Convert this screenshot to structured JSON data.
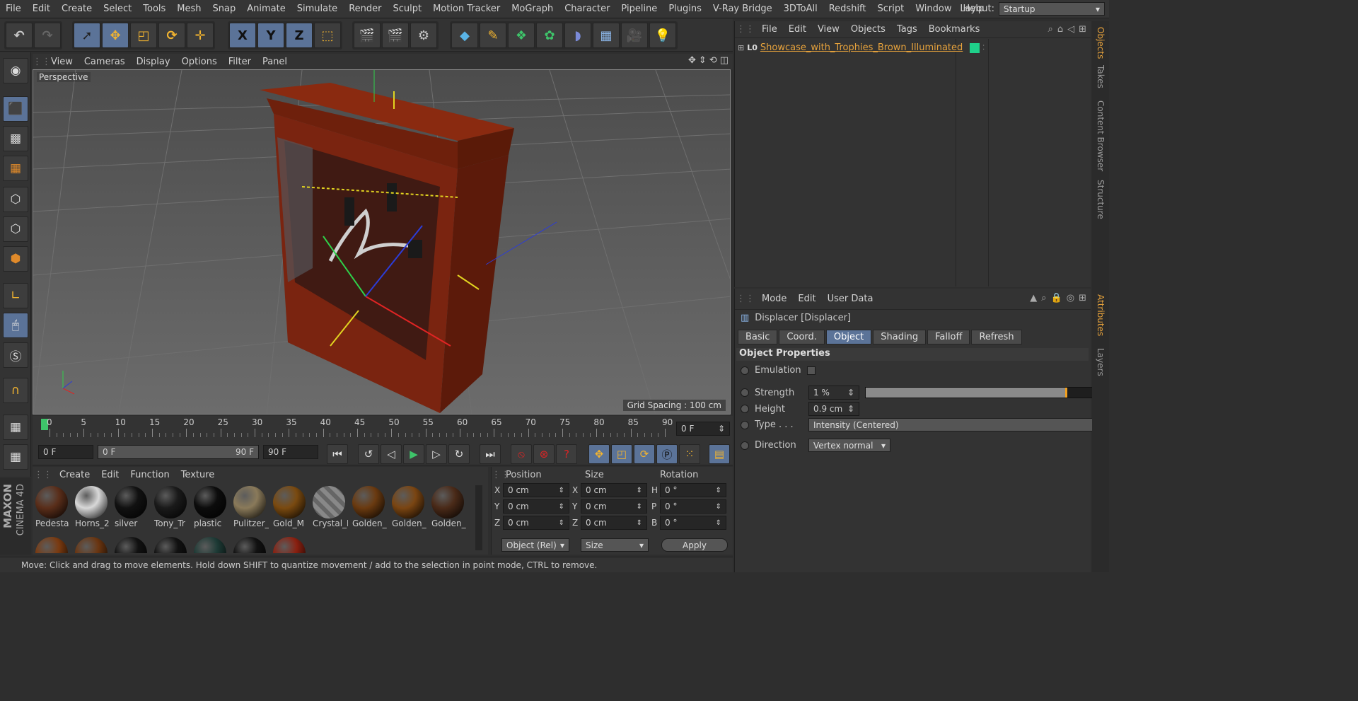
{
  "menubar": {
    "items": [
      "File",
      "Edit",
      "Create",
      "Select",
      "Tools",
      "Mesh",
      "Snap",
      "Animate",
      "Simulate",
      "Render",
      "Sculpt",
      "Motion Tracker",
      "MoGraph",
      "Character",
      "Pipeline",
      "Plugins",
      "V-Ray Bridge",
      "3DToAll",
      "Redshift",
      "Script",
      "Window",
      "Help"
    ],
    "layout_label": "Layout:",
    "layout_value": "Startup"
  },
  "toolbar": {
    "axes": [
      "X",
      "Y",
      "Z"
    ]
  },
  "viewport": {
    "menu": [
      "View",
      "Cameras",
      "Display",
      "Options",
      "Filter",
      "Panel"
    ],
    "label": "Perspective",
    "grid_spacing": "Grid Spacing : 100 cm"
  },
  "timeline": {
    "ticks": [
      "0",
      "5",
      "10",
      "15",
      "20",
      "25",
      "30",
      "35",
      "40",
      "45",
      "50",
      "55",
      "60",
      "65",
      "70",
      "75",
      "80",
      "85",
      "90"
    ],
    "current_frame": "0 F"
  },
  "transport": {
    "start": "0 F",
    "range_start": "0 F",
    "range_end": "90 F",
    "end": "90 F"
  },
  "materials": {
    "menu": [
      "Create",
      "Edit",
      "Function",
      "Texture"
    ],
    "items": [
      {
        "name": "Pedesta",
        "color": "#5a2e1a"
      },
      {
        "name": "Horns_2",
        "color": "#d8d8d8"
      },
      {
        "name": "silver",
        "color": "#111111"
      },
      {
        "name": "Tony_Tr",
        "color": "#1a1a1a"
      },
      {
        "name": "plastic",
        "color": "#0c0c0c"
      },
      {
        "name": "Pulitzer_",
        "color": "#8a7a5a"
      },
      {
        "name": "Gold_M",
        "color": "#7a4a10"
      },
      {
        "name": "Crystal_I",
        "color": "#777777"
      },
      {
        "name": "Golden_",
        "color": "#6a3a10"
      },
      {
        "name": "Golden_",
        "color": "#7a4512"
      },
      {
        "name": "Golden_",
        "color": "#4a2a18"
      }
    ],
    "row2": [
      "#7a3a10",
      "#6a3510",
      "#111111",
      "#111111",
      "#1d3a35",
      "#111111",
      "#8a2010"
    ]
  },
  "coords": {
    "headers": [
      "Position",
      "Size",
      "Rotation"
    ],
    "rows": [
      {
        "a": "X",
        "p": "0 cm",
        "b": "X",
        "s": "0 cm",
        "c": "H",
        "r": "0 °"
      },
      {
        "a": "Y",
        "p": "0 cm",
        "b": "Y",
        "s": "0 cm",
        "c": "P",
        "r": "0 °"
      },
      {
        "a": "Z",
        "p": "0 cm",
        "b": "Z",
        "s": "0 cm",
        "c": "B",
        "r": "0 °"
      }
    ],
    "mode": "Object (Rel)",
    "size_mode": "Size",
    "apply": "Apply"
  },
  "status": "Move: Click and drag to move elements. Hold down SHIFT to quantize movement / add to the selection in point mode, CTRL to remove.",
  "objects": {
    "menu": [
      "File",
      "Edit",
      "View",
      "Objects",
      "Tags",
      "Bookmarks"
    ],
    "item": "Showcase_with_Trophies_Brown_Illuminated",
    "item_color": "#e6a23c"
  },
  "attributes": {
    "menu": [
      "Mode",
      "Edit",
      "User Data"
    ],
    "title": "Displacer [Displacer]",
    "tabs": [
      "Basic",
      "Coord.",
      "Object",
      "Shading",
      "Falloff",
      "Refresh"
    ],
    "active_tab": "Object",
    "section": "Object Properties",
    "emulation_label": "Emulation",
    "strength_label": "Strength",
    "strength": "1 %",
    "strength_fraction": 0.84,
    "height_label": "Height",
    "height": "0.9 cm",
    "type_label": "Type . . .",
    "type": "Intensity (Centered)",
    "direction_label": "Direction",
    "direction": "Vertex normal"
  },
  "sidetabs": [
    "Objects",
    "Takes",
    "Content Browser",
    "Structure",
    "Attributes",
    "Layers"
  ],
  "brand": {
    "line1": "MAXON",
    "line2": "CINEMA 4D"
  }
}
